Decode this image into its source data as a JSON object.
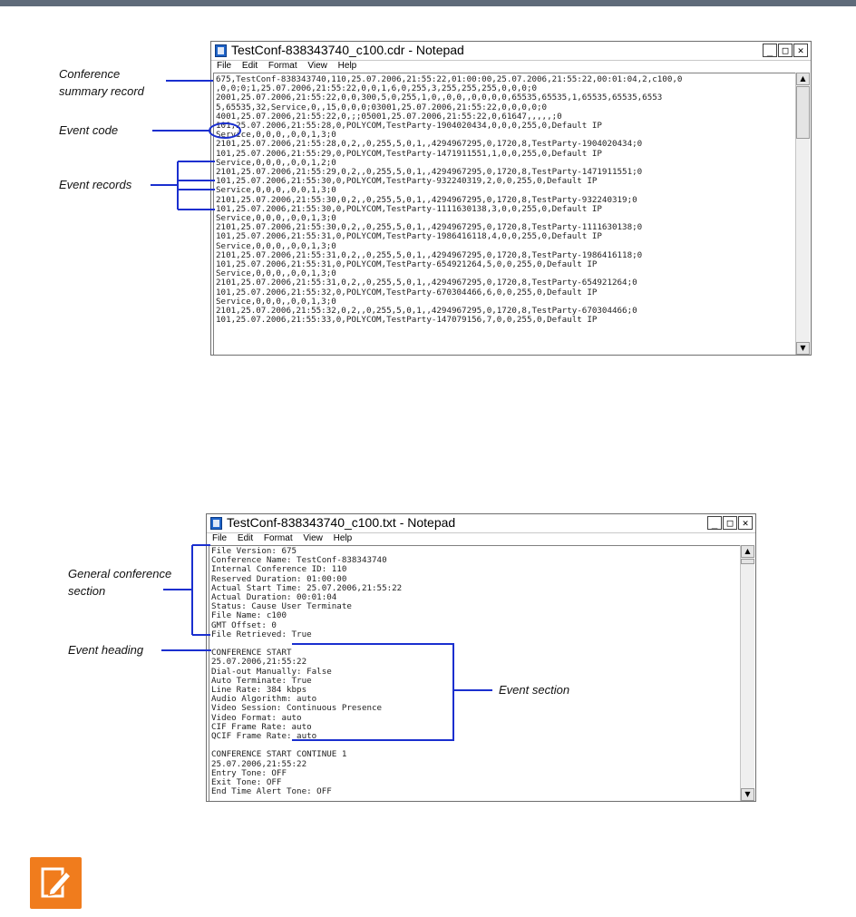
{
  "colors": {
    "accent_line": "#1a2fcf",
    "topbar": "#5f6b7a",
    "note_icon": "#f07c1d"
  },
  "window_buttons": {
    "minimize": "_",
    "maximize": "□",
    "close": "✕"
  },
  "scroll_arrows": {
    "up": "▲",
    "down": "▼"
  },
  "cdr_window": {
    "title": "TestConf-838343740_c100.cdr - Notepad",
    "menu": [
      "File",
      "Edit",
      "Format",
      "View",
      "Help"
    ],
    "lines": [
      "675,TestConf-838343740,110,25.07.2006,21:55:22,01:00:00,25.07.2006,21:55:22,00:01:04,2,c100,0",
      ",0,0;0;1,25.07.2006,21:55:22,0,0,1,6,0,255,3,255,255,255,0,0,0;0",
      "2001,25.07.2006,21:55:22,0,0,300,5,0,255,1,0,,0,0,,0,0,0,0,65535,65535,1,65535,65535,6553",
      "5,65535,32,Service,0,,15,0,0,0;03001,25.07.2006,21:55:22,0,0,0,0;0",
      "4001,25.07.2006,21:55:22,0,;;05001,25.07.2006,21:55:22,0,61647,,,,,;0",
      "101,25.07.2006,21:55:28,0,POLYCOM,TestParty-1904020434,0,0,0,255,0,Default IP",
      "Service,0,0,0,,0,0,1,3;0",
      "2101,25.07.2006,21:55:28,0,2,,0,255,5,0,1,,4294967295,0,1720,8,TestParty-1904020434;0",
      "101,25.07.2006,21:55:29,0,POLYCOM,TestParty-1471911551,1,0,0,255,0,Default IP",
      "Service,0,0,0,,0,0,1,2;0",
      "2101,25.07.2006,21:55:29,0,2,,0,255,5,0,1,,4294967295,0,1720,8,TestParty-1471911551;0",
      "101,25.07.2006,21:55:30,0,POLYCOM,TestParty-932240319,2,0,0,255,0,Default IP",
      "Service,0,0,0,,0,0,1,3;0",
      "2101,25.07.2006,21:55:30,0,2,,0,255,5,0,1,,4294967295,0,1720,8,TestParty-932240319;0",
      "101,25.07.2006,21:55:30,0,POLYCOM,TestParty-1111630138,3,0,0,255,0,Default IP",
      "Service,0,0,0,,0,0,1,3;0",
      "2101,25.07.2006,21:55:30,0,2,,0,255,5,0,1,,4294967295,0,1720,8,TestParty-1111630138;0",
      "101,25.07.2006,21:55:31,0,POLYCOM,TestParty-1986416118,4,0,0,255,0,Default IP",
      "Service,0,0,0,,0,0,1,3;0",
      "2101,25.07.2006,21:55:31,0,2,,0,255,5,0,1,,4294967295,0,1720,8,TestParty-1986416118;0",
      "101,25.07.2006,21:55:31,0,POLYCOM,TestParty-654921264,5,0,0,255,0,Default IP",
      "Service,0,0,0,,0,0,1,3;0",
      "2101,25.07.2006,21:55:31,0,2,,0,255,5,0,1,,4294967295,0,1720,8,TestParty-654921264;0",
      "101,25.07.2006,21:55:32,0,POLYCOM,TestParty-670304466,6,0,0,255,0,Default IP",
      "Service,0,0,0,,0,0,1,3;0",
      "2101,25.07.2006,21:55:32,0,2,,0,255,5,0,1,,4294967295,0,1720,8,TestParty-670304466;0",
      "101,25.07.2006,21:55:33,0,POLYCOM,TestParty-147079156,7,0,0,255,0,Default IP"
    ]
  },
  "txt_window": {
    "title": "TestConf-838343740_c100.txt - Notepad",
    "menu": [
      "File",
      "Edit",
      "Format",
      "View",
      "Help"
    ],
    "lines": [
      "File Version: 675",
      "Conference Name: TestConf-838343740",
      "Internal Conference ID: 110",
      "Reserved Duration: 01:00:00",
      "Actual Start Time: 25.07.2006,21:55:22",
      "Actual Duration: 00:01:04",
      "Status: Cause User Terminate",
      "File Name: c100",
      "GMT Offset: 0",
      "File Retrieved: True",
      "",
      "CONFERENCE START",
      "25.07.2006,21:55:22",
      "Dial-out Manually: False",
      "Auto Terminate: True",
      "Line Rate: 384 kbps",
      "Audio Algorithm: auto",
      "Video Session: Continuous Presence",
      "Video Format: auto",
      "CIF Frame Rate: auto",
      "QCIF Frame Rate: auto",
      "",
      "CONFERENCE START CONTINUE 1",
      "25.07.2006,21:55:22",
      "Entry Tone: OFF",
      "Exit Tone: OFF",
      "End Time Alert Tone: OFF"
    ]
  },
  "labels": {
    "conference_summary_record_1": "Conference",
    "conference_summary_record_2": "summary record",
    "event_code": "Event code",
    "event_records": "Event records",
    "general_conference_section_1": "General conference",
    "general_conference_section_2": "section",
    "event_heading": "Event heading",
    "event_section": "Event section"
  }
}
